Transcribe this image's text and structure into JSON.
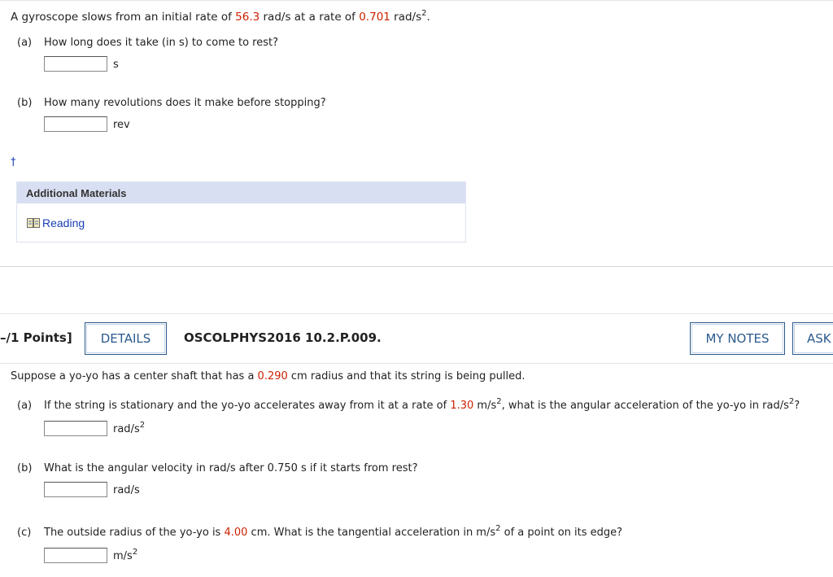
{
  "q1": {
    "stem_pre": "A gyroscope slows from an initial rate of ",
    "rate_initial": "56.3",
    "stem_mid": " rad/s at a rate of ",
    "rate_decel": "0.701",
    "stem_post": " rad/s",
    "stem_exp": "2",
    "stem_end": ".",
    "part_a_label": "(a)",
    "part_a_text": "How long does it take (in s) to come to rest?",
    "part_a_unit": "s",
    "part_b_label": "(b)",
    "part_b_text": "How many revolutions does it make before stopping?",
    "part_b_unit": "rev",
    "dagger": "†",
    "materials_title": "Additional Materials",
    "reading_link": "Reading"
  },
  "q2_header": {
    "points": "–/1 Points]",
    "details_button": "DETAILS",
    "code": "OSCOLPHYS2016 10.2.P.009.",
    "my_notes_button": "MY NOTES",
    "ask_button": "ASK"
  },
  "q2": {
    "stem_pre": "Suppose a yo-yo has a center shaft that has a ",
    "radius": "0.290",
    "stem_post": " cm radius and that its string is being pulled.",
    "part_a_label": "(a)",
    "part_a_pre": "If the string is stationary and the yo-yo accelerates away from it at a rate of ",
    "part_a_accel": "1.30",
    "part_a_mid": " m/s",
    "part_a_exp1": "2",
    "part_a_post": ", what is the angular acceleration of the yo-yo in rad/s",
    "part_a_exp2": "2",
    "part_a_end": "?",
    "part_a_unit": "rad/s",
    "part_a_unit_exp": "2",
    "part_b_label": "(b)",
    "part_b_text": "What is the angular velocity in rad/s after 0.750 s if it starts from rest?",
    "part_b_unit": "rad/s",
    "part_c_label": "(c)",
    "part_c_pre": "The outside radius of the yo-yo is ",
    "part_c_radius": "4.00",
    "part_c_mid": " cm. What is the tangential acceleration in m/s",
    "part_c_exp": "2",
    "part_c_post": " of a point on its edge?",
    "part_c_unit": "m/s",
    "part_c_unit_exp": "2"
  },
  "colors": {
    "value_highlight": "#cc2200",
    "link": "#1a3fb5",
    "button": "#2b5a8c",
    "materials_header_bg": "#d9dff2"
  },
  "icons": {
    "reading": "book-icon"
  }
}
